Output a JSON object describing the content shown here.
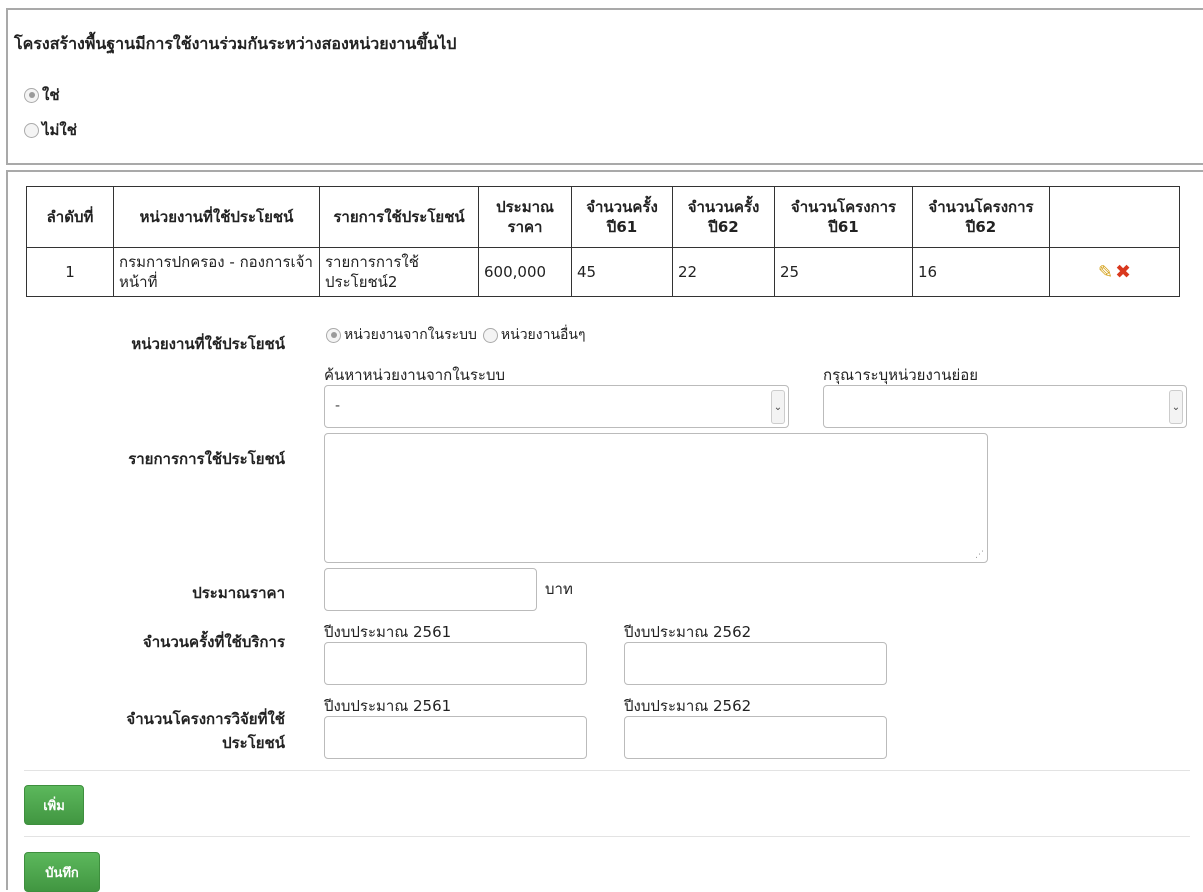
{
  "section": {
    "question": "โครงสร้างพื้นฐานมีการใช้งานร่วมกันระหว่างสองหน่วยงานขึ้นไป",
    "options": [
      {
        "label": "ใช่",
        "checked": true
      },
      {
        "label": "ไม่ใช่",
        "checked": false
      }
    ]
  },
  "table": {
    "headers": [
      "ลำดับที่",
      "หน่วยงานที่ใช้ประโยชน์",
      "รายการใช้ประโยชน์",
      "ประมาณราคา",
      "จำนวนครั้ง ปี61",
      "จำนวนครั้ง ปี62",
      "จำนวนโครงการ ปี61",
      "จำนวนโครงการ ปี62",
      ""
    ],
    "rows": [
      {
        "no": "1",
        "agency": "กรมการปกครอง - กองการเจ้าหน้าที่",
        "usage": "รายการการใช้ประโยชน์2",
        "price": "600,000",
        "times61": "45",
        "times62": "22",
        "projects61": "25",
        "projects62": "16",
        "edit_icon": "pencil-icon",
        "delete_icon": "close-icon"
      }
    ]
  },
  "form": {
    "agency_label": "หน่วยงานที่ใช้ประโยชน์",
    "agency_options": [
      {
        "label": "หน่วยงานจากในระบบ",
        "checked": true
      },
      {
        "label": "หน่วยงานอื่นๆ",
        "checked": false
      }
    ],
    "search_label": "ค้นหาหน่วยงานจากในระบบ",
    "search_value": "-",
    "subagency_label": "กรุณาระบุหน่วยงานย่อย",
    "subagency_value": "",
    "usage_label": "รายการการใช้ประโยชน์",
    "price_label": "ประมาณราคา",
    "price_unit": "บาท",
    "times_label": "จำนวนครั้งที่ใช้บริการ",
    "projects_label_line1": "จำนวนโครงการวิจัยที่ใช้",
    "projects_label_line2": "ประโยชน์",
    "year_2561": "ปีงบประมาณ 2561",
    "year_2562": "ปีงบประมาณ 2562"
  },
  "buttons": {
    "add": "เพิ่ม",
    "save": "บันทึก"
  },
  "colors": {
    "button_green": "#4cae4c",
    "delete_red": "#d9381e",
    "edit_yellow": "#d4a017"
  }
}
